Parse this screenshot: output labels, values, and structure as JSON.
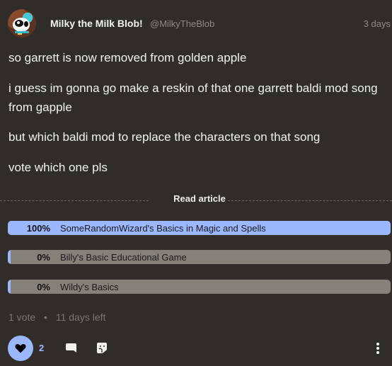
{
  "post": {
    "author": {
      "display_name": "Milky the Milk Blob!",
      "handle": "@MilkyTheBlob"
    },
    "timestamp": "3 days",
    "paragraphs": [
      "so garrett is now removed from golden apple",
      "i guess im gonna go make a reskin of that one garrett baldi mod song from gapple",
      "but which baldi mod to replace the characters on that song",
      "vote which one pls"
    ],
    "read_article_label": "Read article"
  },
  "poll": {
    "options": [
      {
        "percent_label": "100%",
        "percent": 100,
        "label": "SomeRandomWizard's Basics in Magic and Spells"
      },
      {
        "percent_label": "0%",
        "percent": 0,
        "label": "Billy's Basic Educational Game"
      },
      {
        "percent_label": "0%",
        "percent": 0,
        "label": "Wildy's Basics"
      }
    ],
    "votes_label": "1 vote",
    "separator": "•",
    "time_left_label": "11 days left"
  },
  "actions": {
    "like_count": "2",
    "icons": {
      "like": "heart-icon",
      "comment": "speech-bubble-icon",
      "react": "sticker-icon",
      "more": "vertical-ellipsis-icon"
    }
  },
  "colors": {
    "background": "#302c2a",
    "accent": "#9bb8ff",
    "poll_track": "#858079",
    "muted_text": "#8f8a86"
  }
}
